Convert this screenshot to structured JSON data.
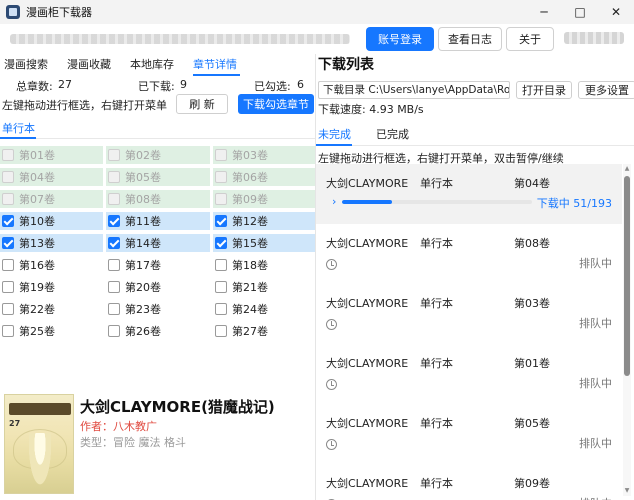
{
  "window": {
    "title": "漫画柜下载器",
    "min": "─",
    "max": "□",
    "close": "✕"
  },
  "topbar": {
    "login": "账号登录",
    "log": "查看日志",
    "about": "关于"
  },
  "tabs": [
    "漫画搜索",
    "漫画收藏",
    "本地库存",
    "章节详情"
  ],
  "active_tab": 3,
  "stats": {
    "total_label": "总章数:",
    "total": "27",
    "downloaded_label": "已下载:",
    "downloaded": "9",
    "checked_label": "已勾选:",
    "checked": "6"
  },
  "hint_left": "左键拖动进行框选，右键打开菜单",
  "refresh_label": "刷 新",
  "download_selected_label": "下载勾选章节",
  "subtab": "单行本",
  "chapters": [
    {
      "label": "第01卷",
      "state": "done"
    },
    {
      "label": "第02卷",
      "state": "done"
    },
    {
      "label": "第03卷",
      "state": "done"
    },
    {
      "label": "第04卷",
      "state": "done"
    },
    {
      "label": "第05卷",
      "state": "done"
    },
    {
      "label": "第06卷",
      "state": "done"
    },
    {
      "label": "第07卷",
      "state": "done"
    },
    {
      "label": "第08卷",
      "state": "done"
    },
    {
      "label": "第09卷",
      "state": "done"
    },
    {
      "label": "第10卷",
      "state": "sel"
    },
    {
      "label": "第11卷",
      "state": "sel"
    },
    {
      "label": "第12卷",
      "state": "sel"
    },
    {
      "label": "第13卷",
      "state": "sel"
    },
    {
      "label": "第14卷",
      "state": "sel"
    },
    {
      "label": "第15卷",
      "state": "sel"
    },
    {
      "label": "第16卷",
      "state": "none"
    },
    {
      "label": "第17卷",
      "state": "none"
    },
    {
      "label": "第18卷",
      "state": "none"
    },
    {
      "label": "第19卷",
      "state": "none"
    },
    {
      "label": "第20卷",
      "state": "none"
    },
    {
      "label": "第21卷",
      "state": "none"
    },
    {
      "label": "第22卷",
      "state": "none"
    },
    {
      "label": "第23卷",
      "state": "none"
    },
    {
      "label": "第24卷",
      "state": "none"
    },
    {
      "label": "第25卷",
      "state": "none"
    },
    {
      "label": "第26卷",
      "state": "none"
    },
    {
      "label": "第27卷",
      "state": "none"
    }
  ],
  "comic": {
    "title": "大剑CLAYMORE(猎魔战记)",
    "author": "作者：八木教广",
    "type": "类型：冒险 魔法 格斗",
    "cover_num": "27"
  },
  "download_panel": {
    "title": "下载列表",
    "dir_label": "下载目录 C:\\Users\\lanye\\AppData\\Roaming",
    "open_dir": "打开目录",
    "more_settings": "更多设置",
    "speed": "下载速度: 4.93 MB/s",
    "tab_unfinished": "未完成",
    "tab_finished": "已完成",
    "hint": "左键拖动进行框选，右键打开菜单，双击暂停/继续",
    "items": [
      {
        "name": "大剑CLAYMORE",
        "type": "单行本",
        "vol": "第04卷",
        "status": "下载中 51/193",
        "progress": 0.2642,
        "active": true
      },
      {
        "name": "大剑CLAYMORE",
        "type": "单行本",
        "vol": "第08卷",
        "status": "排队中",
        "active": false
      },
      {
        "name": "大剑CLAYMORE",
        "type": "单行本",
        "vol": "第03卷",
        "status": "排队中",
        "active": false
      },
      {
        "name": "大剑CLAYMORE",
        "type": "单行本",
        "vol": "第01卷",
        "status": "排队中",
        "active": false
      },
      {
        "name": "大剑CLAYMORE",
        "type": "单行本",
        "vol": "第05卷",
        "status": "排队中",
        "active": false
      },
      {
        "name": "大剑CLAYMORE",
        "type": "单行本",
        "vol": "第09卷",
        "status": "排队中",
        "active": false
      }
    ]
  }
}
